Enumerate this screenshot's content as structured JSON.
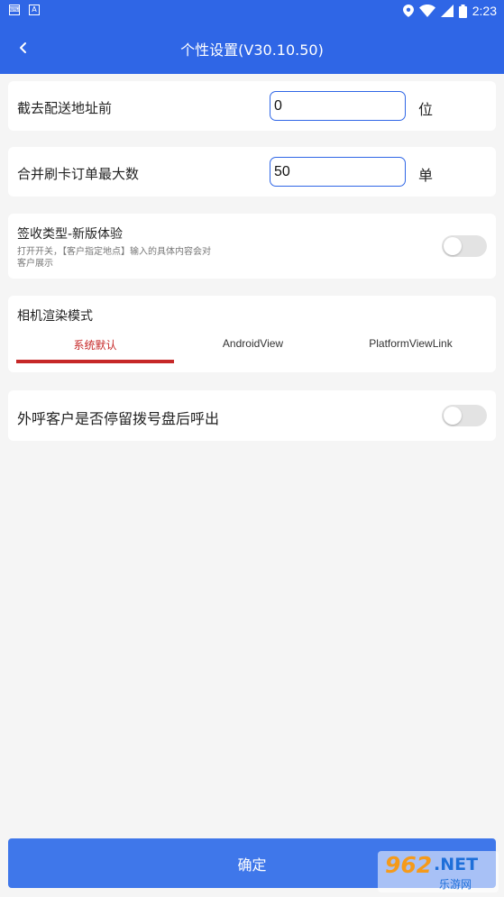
{
  "status_bar": {
    "time": "2:23",
    "icons": [
      "keyboard-icon",
      "a-icon",
      "location-icon",
      "wifi-icon",
      "signal-icon",
      "battery-icon"
    ]
  },
  "app_bar": {
    "title": "个性设置(V30.10.50)",
    "back_icon": "chevron-left-icon"
  },
  "settings": {
    "truncate_address": {
      "label": "截去配送地址前",
      "value": "0",
      "unit": "位"
    },
    "merge_card_max": {
      "label": "合并刷卡订单最大数",
      "value": "50",
      "unit": "单"
    },
    "sign_type": {
      "label": "签收类型-新版体验",
      "description": "打开开关，【客户指定地点】输入的具体内容会对客户展示",
      "enabled": false
    },
    "camera_render": {
      "label": "相机渲染模式",
      "tabs": [
        "系统默认",
        "AndroidView",
        "PlatformViewLink"
      ],
      "selected_index": 0
    },
    "outbound_call": {
      "label": "外呼客户是否停留拨号盘后呼出",
      "enabled": false
    }
  },
  "footer": {
    "confirm_label": "确定"
  },
  "watermark": {
    "number": "962",
    "domain": ".NET",
    "site_name": "乐游网"
  },
  "colors": {
    "primary": "#2f66e6",
    "confirm": "#3f77ea",
    "accent_red": "#c62828",
    "background": "#f5f5f5"
  }
}
